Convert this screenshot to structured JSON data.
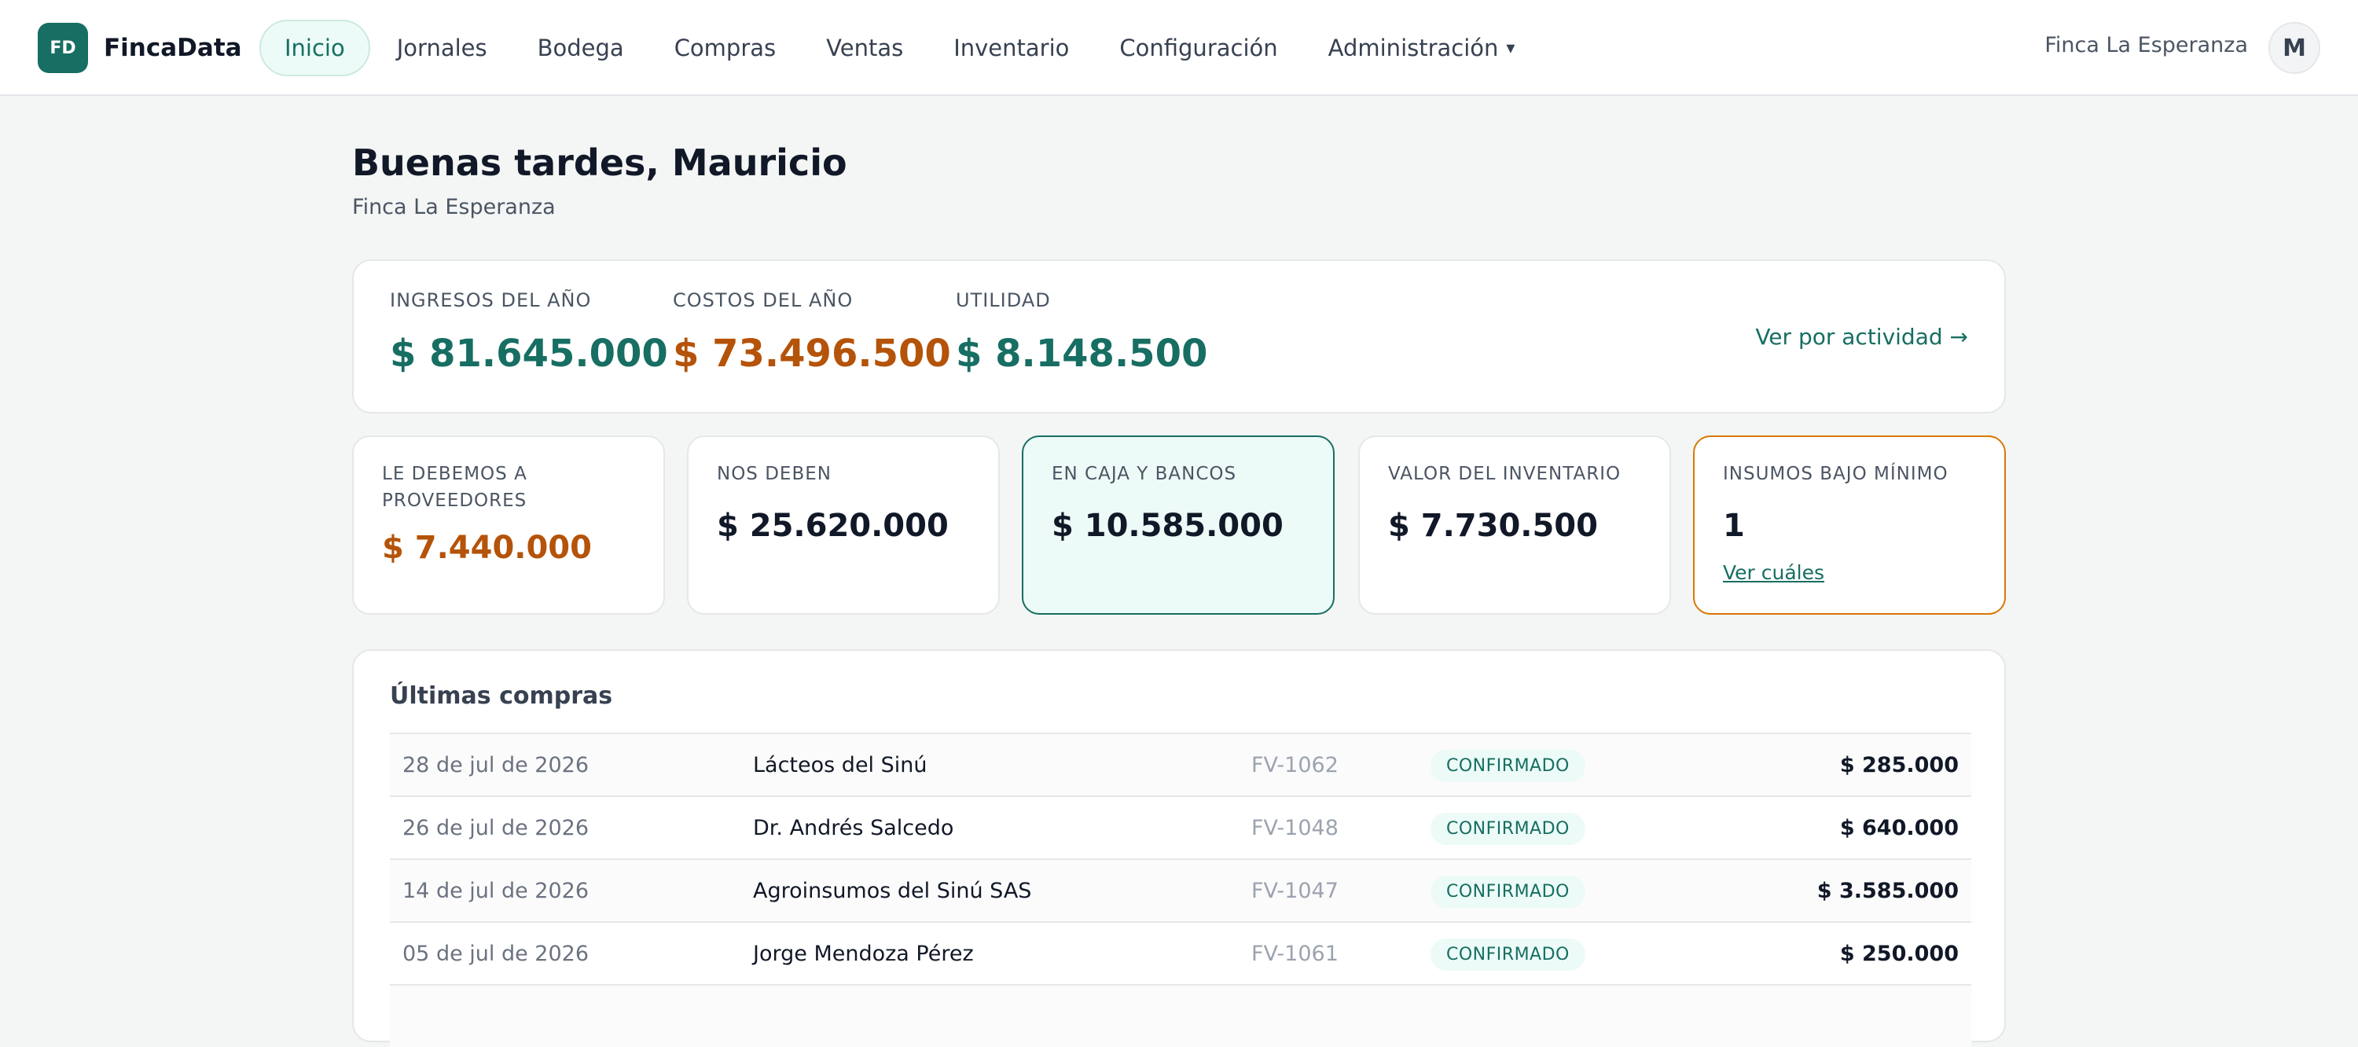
{
  "brand": {
    "logo_text": "FD",
    "name": "FincaData"
  },
  "nav": {
    "items": [
      {
        "label": "Inicio",
        "active": true
      },
      {
        "label": "Jornales"
      },
      {
        "label": "Bodega"
      },
      {
        "label": "Compras"
      },
      {
        "label": "Ventas"
      },
      {
        "label": "Inventario"
      },
      {
        "label": "Configuración"
      },
      {
        "label": "Administración"
      }
    ],
    "caret": "▾"
  },
  "header": {
    "farm_name": "Finca La Esperanza",
    "avatar_initial": "M"
  },
  "page": {
    "greeting": "Buenas tardes, Mauricio",
    "subtitle": "Finca La Esperanza"
  },
  "summary": {
    "income_label": "INGRESOS DEL AÑO",
    "income_value": "$ 81.645.000",
    "costs_label": "COSTOS DEL AÑO",
    "costs_value": "$ 73.496.500",
    "profit_label": "UTILIDAD",
    "profit_value": "$ 8.148.500",
    "link": "Ver por actividad →"
  },
  "cards": {
    "suppliers_label": "LE DEBEMOS A PROVEEDORES",
    "suppliers_value": "$ 7.440.000",
    "receivable_label": "NOS DEBEN",
    "receivable_value": "$ 25.620.000",
    "cash_label": "EN CAJA Y BANCOS",
    "cash_value": "$ 10.585.000",
    "inventory_label": "VALOR DEL INVENTARIO",
    "inventory_value": "$ 7.730.500",
    "low_stock_label": "INSUMOS BAJO MÍNIMO",
    "low_stock_value": "1",
    "low_stock_link": "Ver cuáles"
  },
  "purchases": {
    "title": "Últimas compras",
    "rows": [
      {
        "date": "28 de jul de 2026",
        "provider": "Lácteos del Sinú",
        "invoice": "FV-1062",
        "status": "CONFIRMADO",
        "amount": "$ 285.000"
      },
      {
        "date": "26 de jul de 2026",
        "provider": "Dr. Andrés Salcedo",
        "invoice": "FV-1048",
        "status": "CONFIRMADO",
        "amount": "$ 640.000"
      },
      {
        "date": "14 de jul de 2026",
        "provider": "Agroinsumos del Sinú SAS",
        "invoice": "FV-1047",
        "status": "CONFIRMADO",
        "amount": "$ 3.585.000"
      },
      {
        "date": "05 de jul de 2026",
        "provider": "Jorge Mendoza Pérez",
        "invoice": "FV-1061",
        "status": "CONFIRMADO",
        "amount": "$ 250.000"
      }
    ]
  },
  "colors": {
    "accent": "#176e62",
    "cost": "#b45309",
    "alert_border": "#d97706"
  }
}
